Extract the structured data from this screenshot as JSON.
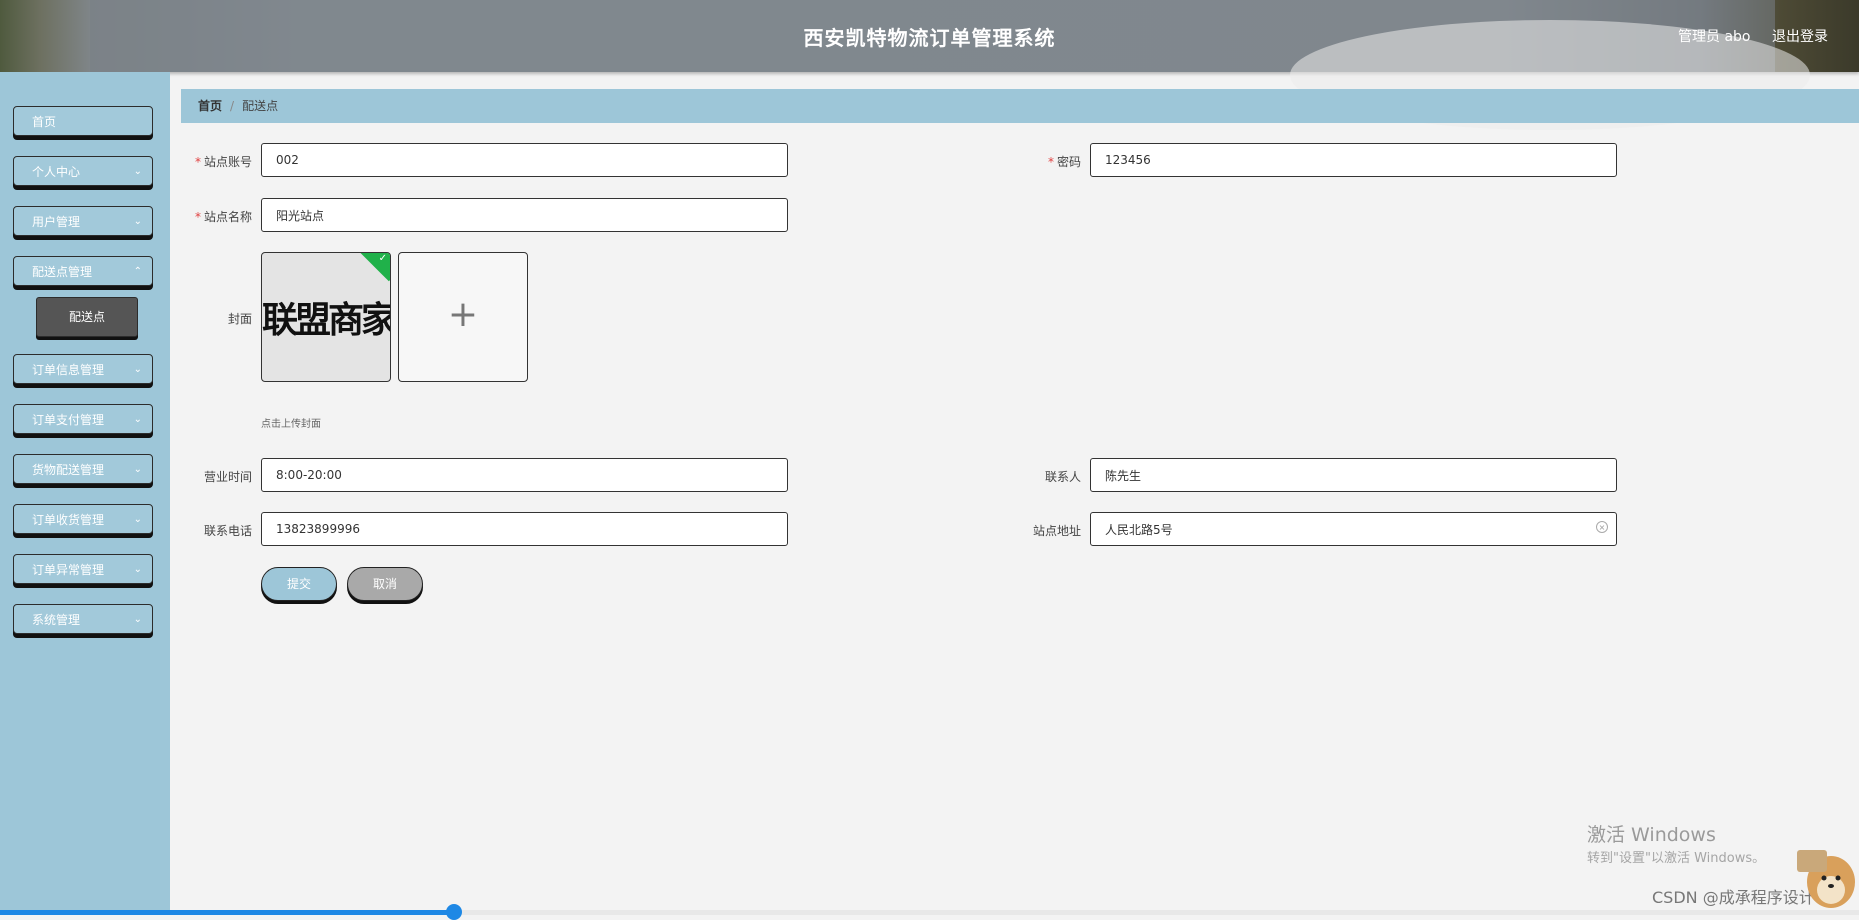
{
  "header": {
    "title": "西安凯特物流订单管理系统",
    "user": "管理员 abo",
    "logout": "退出登录"
  },
  "sidebar": {
    "items": [
      {
        "label": "首页"
      },
      {
        "label": "个人中心"
      },
      {
        "label": "用户管理"
      },
      {
        "label": "配送点管理"
      },
      {
        "label": "订单信息管理"
      },
      {
        "label": "订单支付管理"
      },
      {
        "label": "货物配送管理"
      },
      {
        "label": "订单收货管理"
      },
      {
        "label": "订单异常管理"
      },
      {
        "label": "系统管理"
      }
    ],
    "active_sub": "配送点"
  },
  "breadcrumb": {
    "home": "首页",
    "separator": "/",
    "current": "配送点"
  },
  "form": {
    "account": {
      "label": "站点账号",
      "value": "002"
    },
    "password": {
      "label": "密码",
      "value": "123456"
    },
    "name": {
      "label": "站点名称",
      "value": "阳光站点"
    },
    "cover": {
      "label": "封面",
      "thumb_text": "联盟商家",
      "hint": "点击上传封面",
      "add_icon": "+"
    },
    "hours": {
      "label": "营业时间",
      "value": "8:00-20:00"
    },
    "contact": {
      "label": "联系人",
      "value": "陈先生"
    },
    "phone": {
      "label": "联系电话",
      "value": "13823899996"
    },
    "address": {
      "label": "站点地址",
      "value": "人民北路5号"
    },
    "required_mark": "*",
    "submit": "提交",
    "cancel": "取消"
  },
  "watermarks": {
    "activate": "激活 Windows",
    "activate_sub": "转到\"设置\"以激活 Windows。",
    "csdn": "CSDN @成承程序设计"
  },
  "colors": {
    "accent": "#9dc6d8",
    "active_sub": "#555555",
    "required": "#e04040"
  }
}
